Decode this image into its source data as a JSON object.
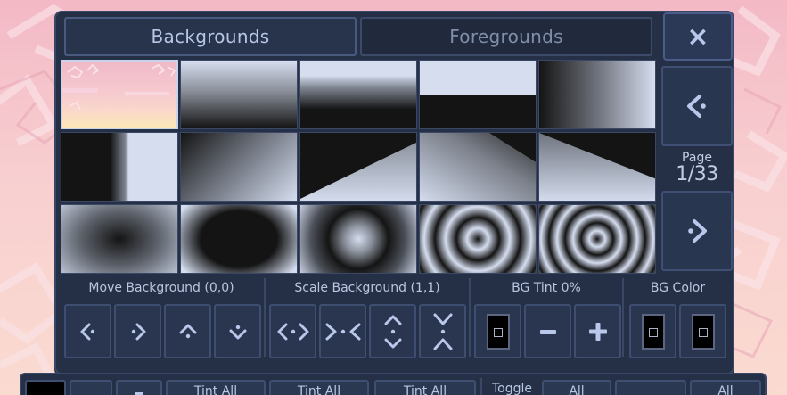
{
  "tabs": {
    "backgrounds": "Backgrounds",
    "foregrounds": "Foregrounds"
  },
  "close_icon": "×",
  "pagination": {
    "label": "Page",
    "value": "1/33"
  },
  "thumbnails": [
    "pink-spiral-pattern",
    "vertical-gradient-light-dark",
    "horizontal-split-gradient",
    "hard-horizontal-split",
    "horizontal-gradient-dark-light",
    "vertical-split-dark-light",
    "diagonal-gradient",
    "trapezoid-light-bottom",
    "diagonal-gradient-right",
    "triangle-light-bottom",
    "radial-dark-center",
    "radial-dark-ellipse",
    "radial-light-center",
    "concentric-rings-few",
    "concentric-rings-many"
  ],
  "controls": {
    "move": {
      "label": "Move Background (0,0)"
    },
    "scale": {
      "label": "Scale Background (1,1)"
    },
    "tint": {
      "label": "BG Tint 0%"
    },
    "color": {
      "label": "BG Color"
    }
  },
  "toolbar": {
    "tint_all_1": "Tint All",
    "tint_all_2": "Tint All",
    "tint_all_3": "Tint All",
    "toggle": "Toggle",
    "all_1": "All",
    "all_2": "All"
  },
  "colors": {
    "panel": "#253046",
    "border": "#384767",
    "accent": "#8a6fd1",
    "text": "#b9c6e0"
  }
}
